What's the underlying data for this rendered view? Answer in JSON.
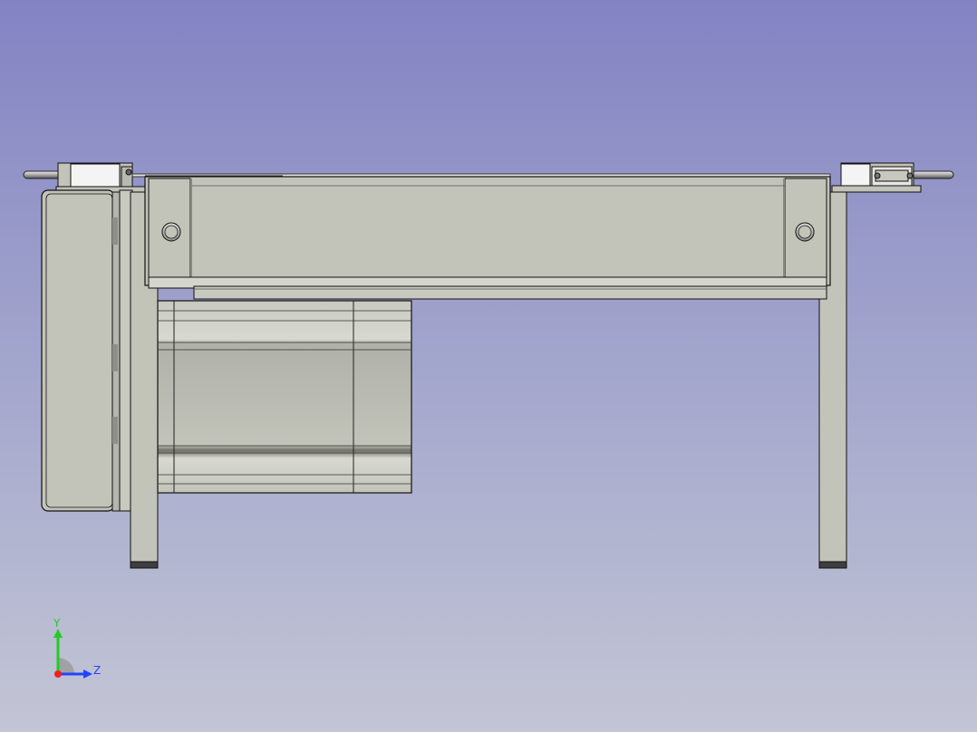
{
  "viewport": {
    "background_top": "#8383c3",
    "background_bottom": "#c3c5d5"
  },
  "model": {
    "part_fill": "#c2c3b9",
    "part_light": "#e6e6e2",
    "edge_color": "#111111",
    "shadow_color": "#3a3a3a"
  },
  "axes": {
    "y_label": "Y",
    "z_label": "Z",
    "y_color": "#22cc22",
    "z_color": "#2244ff",
    "x_color": "#ee2222"
  }
}
